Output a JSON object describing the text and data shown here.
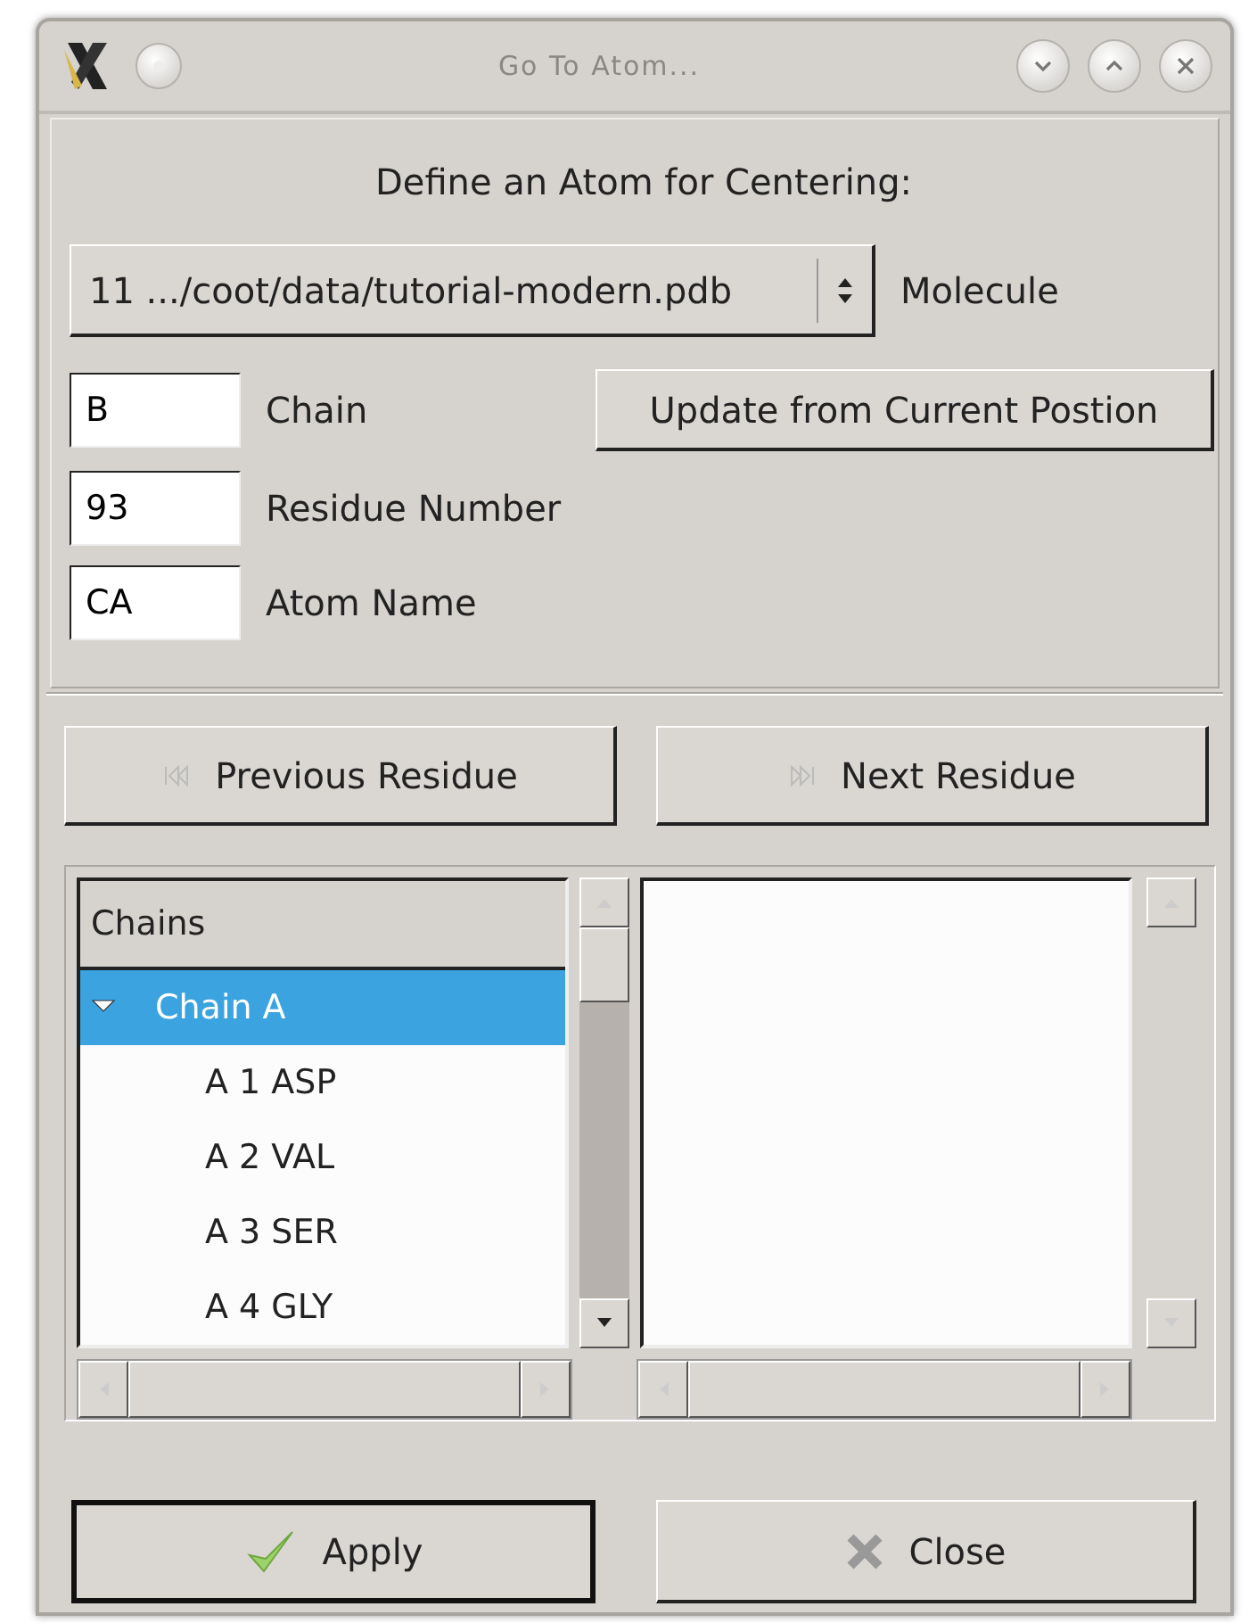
{
  "window": {
    "title": "Go To Atom..."
  },
  "heading": "Define an Atom for Centering:",
  "molecule": {
    "value": "11 .../coot/data/tutorial-modern.pdb",
    "label": "Molecule"
  },
  "fields": [
    {
      "value": "B",
      "label": "Chain"
    },
    {
      "value": "93",
      "label": "Residue Number"
    },
    {
      "value": "CA",
      "label": "Atom Name"
    }
  ],
  "update_button": "Update from Current Postion",
  "nav_buttons": [
    {
      "label": "Previous Residue",
      "kind": "previous"
    },
    {
      "label": "Next Residue",
      "kind": "next"
    }
  ],
  "tree": {
    "column": "Chains",
    "items": [
      {
        "label": "Chain A",
        "selected": true,
        "expanded": true,
        "children": [
          {
            "label": "A 1 ASP",
            "selected": false
          },
          {
            "label": "A 2 VAL",
            "selected": false
          },
          {
            "label": "A 3 SER",
            "selected": false
          },
          {
            "label": "A 4 GLY",
            "selected": false
          }
        ]
      }
    ]
  },
  "buttons": [
    {
      "label": "Apply",
      "kind": "apply",
      "focused": true
    },
    {
      "label": "Close",
      "kind": "close",
      "focused": false
    }
  ]
}
